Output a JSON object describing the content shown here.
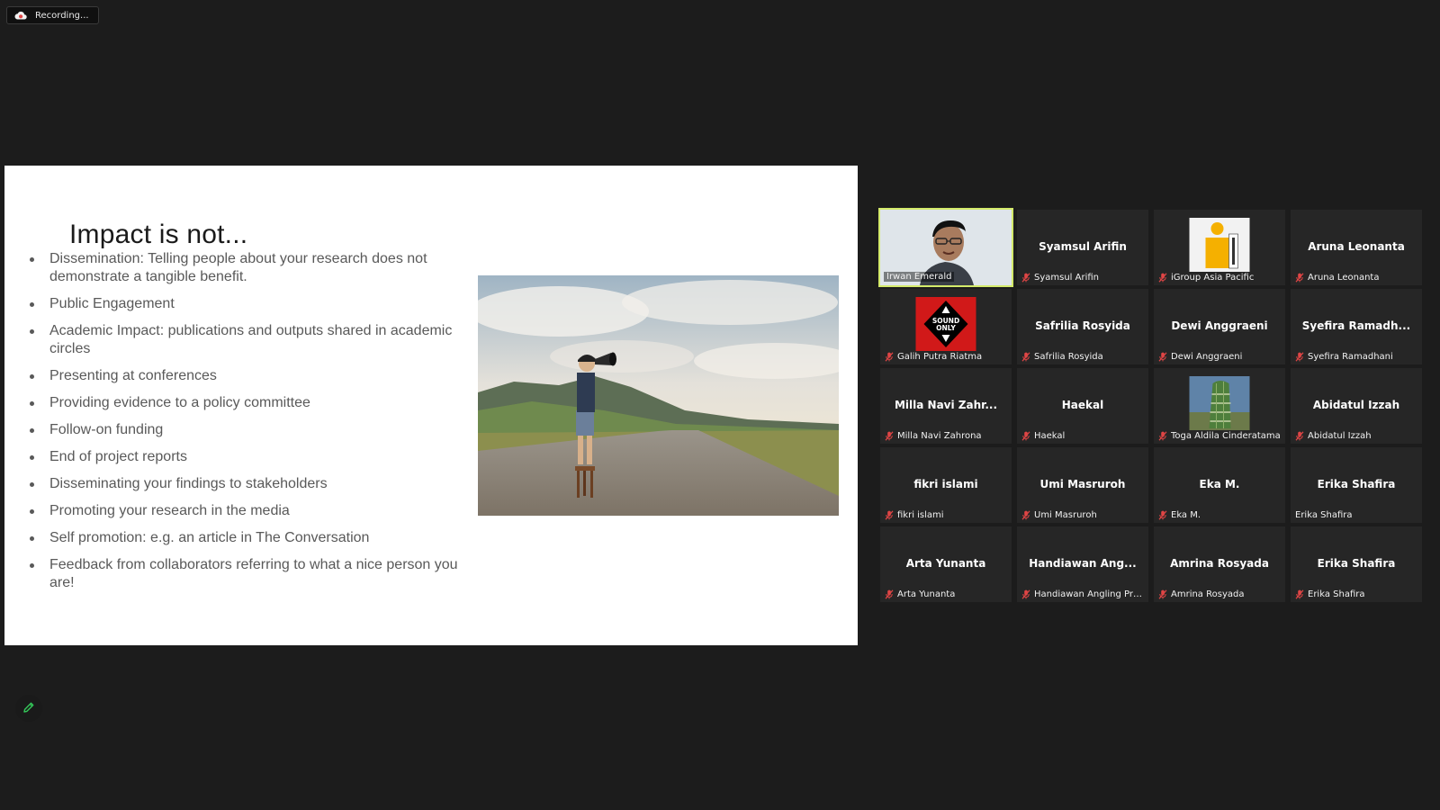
{
  "recording": {
    "label": "Recording..."
  },
  "slide": {
    "title": "Impact is not...",
    "bullets": [
      "Dissemination: Telling people about your research does not demonstrate a tangible benefit.",
      "Public Engagement",
      "Academic Impact: publications and outputs shared in academic circles",
      "Presenting at conferences",
      "Providing evidence to a policy committee",
      "Follow-on funding",
      "End of project reports",
      "Disseminating your findings to stakeholders",
      "Promoting your research in the media",
      "Self promotion: e.g. an article in The Conversation",
      "Feedback from collaborators referring to what a nice person you are!"
    ]
  },
  "participants": [
    {
      "display": "",
      "label": "Irwan Emerald",
      "muted": false,
      "video": true
    },
    {
      "display": "Syamsul Arifin",
      "label": "Syamsul Arifin",
      "muted": true
    },
    {
      "display": "",
      "label": "iGroup Asia Pacific",
      "muted": true,
      "avatar": "igroup-logo-icon"
    },
    {
      "display": "Aruna Leonanta",
      "label": "Aruna Leonanta",
      "muted": true
    },
    {
      "display": "",
      "label": "Galih Putra Riatma",
      "muted": true,
      "avatar": "sound-only-icon",
      "avatar_text": "SOUND ONLY"
    },
    {
      "display": "Safrilia Rosyida",
      "label": "Safrilia Rosyida",
      "muted": true
    },
    {
      "display": "Dewi Anggraeni",
      "label": "Dewi Anggraeni",
      "muted": true
    },
    {
      "display": "Syefira Ramadh...",
      "label": "Syefira Ramadhani",
      "muted": true
    },
    {
      "display": "Milla Navi Zahr...",
      "label": "Milla Navi Zahrona",
      "muted": true
    },
    {
      "display": "Haekal",
      "label": "Haekal",
      "muted": true
    },
    {
      "display": "",
      "label": "Toga Aldila Cinderatama",
      "muted": true,
      "avatar": "building-photo-icon"
    },
    {
      "display": "Abidatul Izzah",
      "label": "Abidatul Izzah",
      "muted": true
    },
    {
      "display": "fikri islami",
      "label": "fikri islami",
      "muted": true
    },
    {
      "display": "Umi Masruroh",
      "label": "Umi Masruroh",
      "muted": true
    },
    {
      "display": "Eka M.",
      "label": "Eka M.",
      "muted": true
    },
    {
      "display": "Erika Shafira",
      "label": "Erika Shafira",
      "muted": false
    },
    {
      "display": "Arta Yunanta",
      "label": "Arta Yunanta",
      "muted": true
    },
    {
      "display": "Handiawan Ang...",
      "label": "Handiawan Angling Pray...",
      "muted": true
    },
    {
      "display": "Amrina Rosyada",
      "label": "Amrina Rosyada",
      "muted": true
    },
    {
      "display": "Erika Shafira",
      "label": "Erika Shafira",
      "muted": true
    }
  ],
  "colors": {
    "active_speaker": "#d4ea6b",
    "muted": "#e04545",
    "tile_bg": "#262626"
  },
  "tools": {
    "annotate": "pencil-icon"
  }
}
